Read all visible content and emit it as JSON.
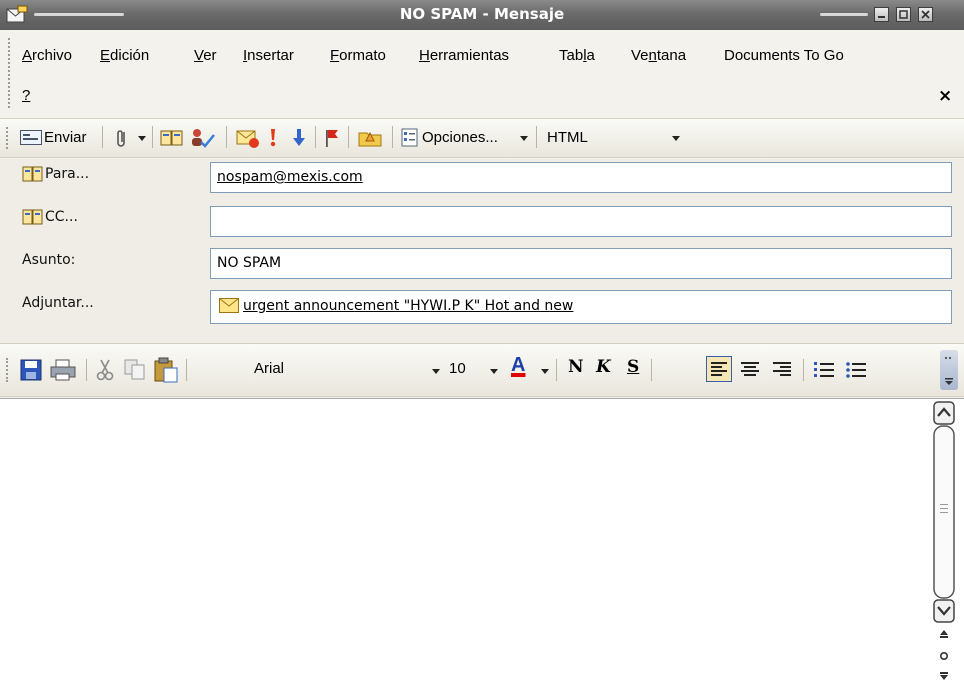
{
  "window": {
    "title": "NO SPAM - Mensaje",
    "controls": [
      "minimize",
      "maximize",
      "close"
    ]
  },
  "menu": {
    "items": [
      {
        "label": "Archivo",
        "accel_index": 0
      },
      {
        "label": "Edición",
        "accel_index": 0
      },
      {
        "label": "Ver",
        "accel_index": 0
      },
      {
        "label": "Insertar",
        "accel_index": 0
      },
      {
        "label": "Formato",
        "accel_index": 0
      },
      {
        "label": "Herramientas",
        "accel_index": 0
      },
      {
        "label": "Tabla",
        "accel_index": 3
      },
      {
        "label": "Ventana",
        "accel_index": 2
      },
      {
        "label": "Documents To Go",
        "accel_index": -1
      },
      {
        "label": "?",
        "accel_index": 0
      }
    ],
    "close_glyph": "×"
  },
  "toolbar": {
    "send_label": "Enviar",
    "options_label": "Opciones...",
    "format_value": "HTML"
  },
  "fields": {
    "to_label": "Para...",
    "to_value": "nospam@mexis.com",
    "cc_label": "CC...",
    "cc_value": "",
    "subject_label": "Asunto:",
    "subject_value": "NO SPAM",
    "attach_label": "Adjuntar...",
    "attach_value": "urgent announcement \"HYWI.P K\" Hot and new"
  },
  "format_toolbar": {
    "font_value": "Arial",
    "size_value": "10",
    "bold_label": "N",
    "italic_label": "K",
    "underline_label": "S"
  },
  "body": {
    "text": ""
  },
  "colors": {
    "title_bar": "#6a6a6a",
    "font_color_bar": "#e00000",
    "input_border": "#7f9db9"
  }
}
